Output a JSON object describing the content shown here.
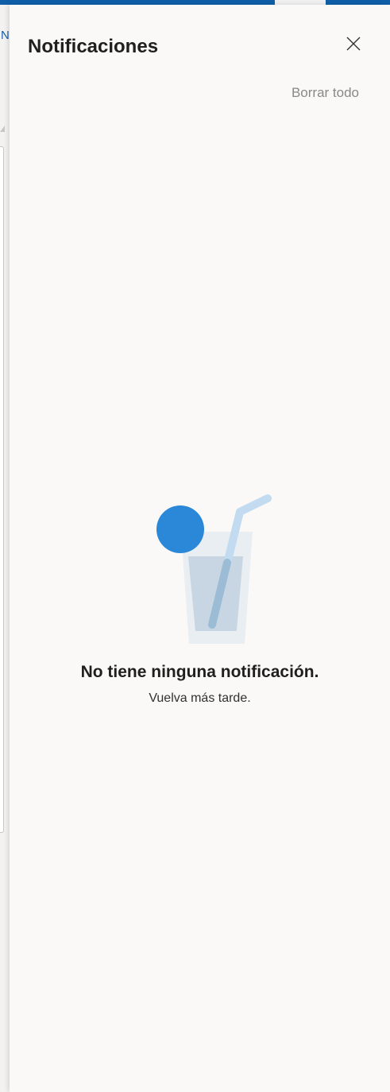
{
  "app": {
    "partial_label": "N"
  },
  "notifications_pane": {
    "title": "Notificaciones",
    "clear_all_label": "Borrar todo",
    "close_icon": "close-icon",
    "empty_state": {
      "illustration_icon": "drink-glass-illustration",
      "heading": "No tiene ninguna notificación.",
      "subtext": "Vuelva más tarde."
    }
  },
  "colors": {
    "accent": "#0f5fa8",
    "pane_background": "#faf9f8",
    "illustration_circle": "#2b88d8",
    "clear_all_text": "#8a8886"
  }
}
